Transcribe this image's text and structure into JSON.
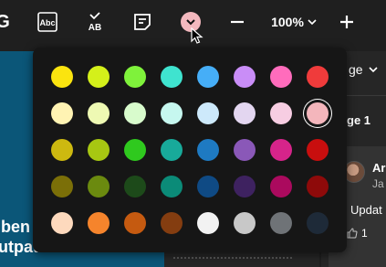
{
  "toolbar": {
    "g_glyph": "G",
    "zoom_label": "100%",
    "color_trigger_color": "#f3b8be"
  },
  "slide": {
    "line1": "iben",
    "line2": "utpat."
  },
  "right_panel": {
    "header_label": "ge",
    "page_label": "ge 1",
    "author": "Ar",
    "date": "Ja",
    "comment": "Updat",
    "likes": "1"
  },
  "palette": {
    "selected": "#f4b6bc",
    "rows": [
      [
        "#fbe40f",
        "#d4f01a",
        "#7ff23b",
        "#3fe3cf",
        "#46aef7",
        "#c98df7",
        "#ff6cbc",
        "#f03b3b"
      ],
      [
        "#fff3b3",
        "#eef9b3",
        "#d8fbcc",
        "#c6f7ef",
        "#cde9fb",
        "#e3d6f0",
        "#f7cde2",
        "#f4b6bc"
      ],
      [
        "#cdb910",
        "#a7c712",
        "#2fc91e",
        "#18aa9a",
        "#1e7ac2",
        "#8a58b8",
        "#d6248a",
        "#c80e0e"
      ],
      [
        "#7b6f08",
        "#6b8a0f",
        "#1d4a1a",
        "#0b8b78",
        "#0f4a84",
        "#3e2260",
        "#ab0a5e",
        "#8e0a0a"
      ],
      [
        "#fdd9bd",
        "#f5842c",
        "#c55a10",
        "#843d10",
        "#f2f2f2",
        "#c8c8c8",
        "#6f7377",
        "#1e2a38"
      ]
    ]
  }
}
